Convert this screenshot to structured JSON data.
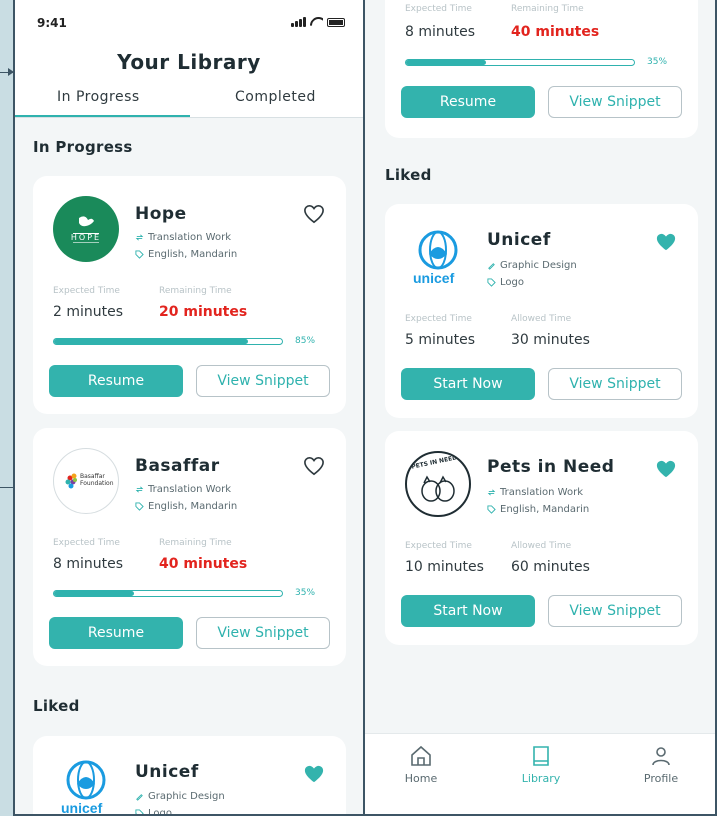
{
  "status": {
    "time": "9:41"
  },
  "header": {
    "title": "Your Library"
  },
  "tabs": [
    {
      "label": "In Progress",
      "active": true
    },
    {
      "label": "Completed",
      "active": false
    }
  ],
  "sections": {
    "in_progress": "In Progress",
    "liked": "Liked"
  },
  "time_labels": {
    "expected": "Expected Time",
    "remaining": "Remaining Time",
    "allowed": "Allowed Time"
  },
  "in_progress": [
    {
      "name": "Hope",
      "category": "Translation Work",
      "languages": "English, Mandarin",
      "expected": "2 minutes",
      "remaining": "20 minutes",
      "progress": "85%",
      "progress_value": 85,
      "liked": false,
      "primary_button": "Resume",
      "secondary_button": "View Snippet",
      "logo_text": "HOPE"
    },
    {
      "name": "Basaffar",
      "category": "Translation Work",
      "languages": "English, Mandarin",
      "expected": "8 minutes",
      "remaining": "40 minutes",
      "progress": "35%",
      "progress_value": 35,
      "liked": false,
      "primary_button": "Resume",
      "secondary_button": "View Snippet",
      "logo_text": "Basaffar Foundation"
    }
  ],
  "right_top_card": {
    "expected_label": "Expected Time",
    "remaining_label": "Remaining Time",
    "expected": "8 minutes",
    "remaining": "40 minutes",
    "progress": "35%",
    "progress_value": 35,
    "primary_button": "Resume",
    "secondary_button": "View Snippet"
  },
  "liked": [
    {
      "name": "Unicef",
      "category": "Graphic Design",
      "tag": "Logo",
      "expected": "5 minutes",
      "allowed": "30 minutes",
      "liked": true,
      "primary_button": "Start Now",
      "secondary_button": "View Snippet",
      "logo_text": "unicef"
    },
    {
      "name": "Pets in Need",
      "category": "Translation Work",
      "tag": "English, Mandarin",
      "expected": "10 minutes",
      "allowed": "60 minutes",
      "liked": true,
      "primary_button": "Start Now",
      "secondary_button": "View Snippet",
      "logo_text": "PETS IN NEED"
    }
  ],
  "left_liked_peek": {
    "name": "Unicef",
    "category": "Graphic Design",
    "tag": "Logo",
    "logo_text": "unicef"
  },
  "nav": [
    {
      "label": "Home",
      "icon": "home-icon",
      "active": false
    },
    {
      "label": "Library",
      "icon": "book-icon",
      "active": true
    },
    {
      "label": "Profile",
      "icon": "user-icon",
      "active": false
    }
  ],
  "colors": {
    "accent": "#33b3ad",
    "remaining_red": "#e2241e",
    "hope_green": "#1a8a5a",
    "unicef_blue": "#1a9be0",
    "background": "#c9dde3"
  }
}
